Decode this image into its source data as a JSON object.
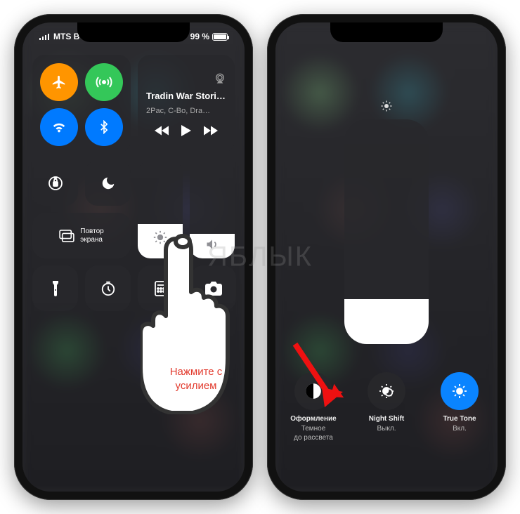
{
  "watermark": "ЯБЛЫК",
  "statusbar": {
    "carrier": "MTS BY",
    "battery_percent": "99 %"
  },
  "music": {
    "title": "Tradin War Stori…",
    "subtitle": "2Pac, C-Bo, Dra…"
  },
  "screen_mirroring": "Повтор\nэкрана",
  "hint_text": "Нажмите с усилием",
  "options": {
    "appearance": {
      "title": "Оформление",
      "sub1": "Темное",
      "sub2": "до рассвета"
    },
    "night_shift": {
      "title": "Night Shift",
      "sub": "Выкл."
    },
    "true_tone": {
      "title": "True Tone",
      "sub": "Вкл."
    }
  }
}
